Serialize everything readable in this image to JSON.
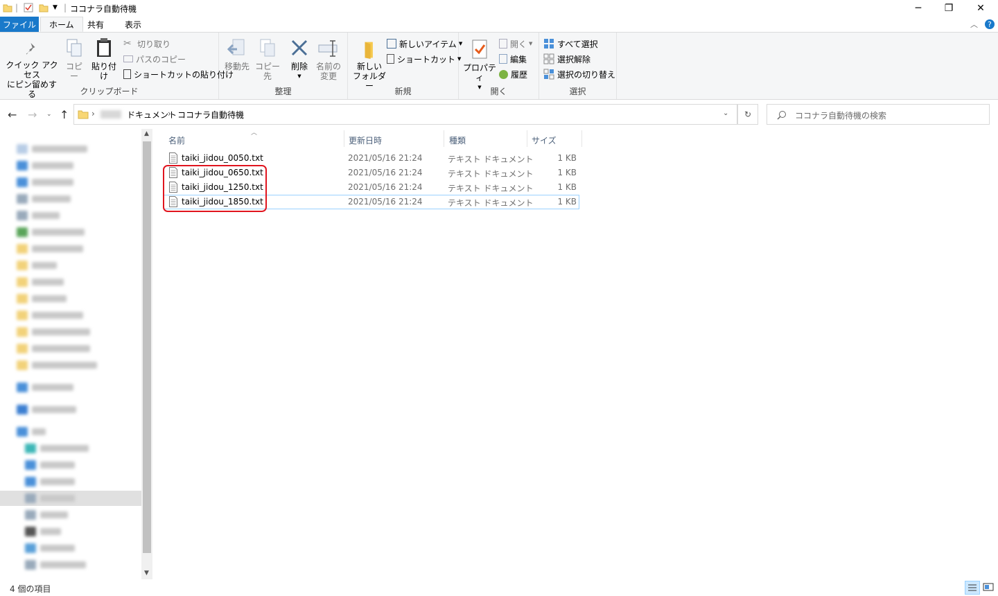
{
  "window": {
    "title": "ココナラ自動待機",
    "minimize": "─",
    "maximize": "❐",
    "close": "✕"
  },
  "tabs": [
    "ファイル",
    "ホーム",
    "共有",
    "表示"
  ],
  "ribbon": {
    "clipboard": {
      "label": "クリップボード",
      "pin": [
        "クイック アクセス",
        "にピン留めする"
      ],
      "copy": "コピー",
      "paste": "貼り付け",
      "cut": "切り取り",
      "copy_path": "パスのコピー",
      "paste_shortcut": "ショートカットの貼り付け"
    },
    "organize": {
      "label": "整理",
      "move_to": "移動先",
      "copy_to": "コピー先",
      "delete": "削除",
      "rename": [
        "名前の",
        "変更"
      ]
    },
    "new": {
      "label": "新規",
      "new_folder": [
        "新しい",
        "フォルダー"
      ],
      "new_item": "新しいアイテム",
      "shortcut": "ショートカット"
    },
    "open": {
      "label": "開く",
      "properties": "プロパティ",
      "open": "開く",
      "edit": "編集",
      "history": "履歴"
    },
    "select": {
      "label": "選択",
      "select_all": "すべて選択",
      "select_none": "選択解除",
      "invert": "選択の切り替え"
    }
  },
  "address": {
    "crumbs": [
      "ドキュメント",
      "ココナラ自動待機"
    ],
    "search_placeholder": "ココナラ自動待機の検索"
  },
  "columns": [
    "名前",
    "更新日時",
    "種類",
    "サイズ"
  ],
  "files": [
    {
      "name": "taiki_jidou_0050.txt",
      "date": "2021/05/16 21:24",
      "type": "テキスト ドキュメント",
      "size": "1 KB"
    },
    {
      "name": "taiki_jidou_0650.txt",
      "date": "2021/05/16 21:24",
      "type": "テキスト ドキュメント",
      "size": "1 KB"
    },
    {
      "name": "taiki_jidou_1250.txt",
      "date": "2021/05/16 21:24",
      "type": "テキスト ドキュメント",
      "size": "1 KB"
    },
    {
      "name": "taiki_jidou_1850.txt",
      "date": "2021/05/16 21:24",
      "type": "テキスト ドキュメント",
      "size": "1 KB"
    }
  ],
  "status": "4 個の項目",
  "colors": {
    "accent": "#1979ca",
    "highlight": "#e0141e",
    "selection": "#99d1ff"
  }
}
